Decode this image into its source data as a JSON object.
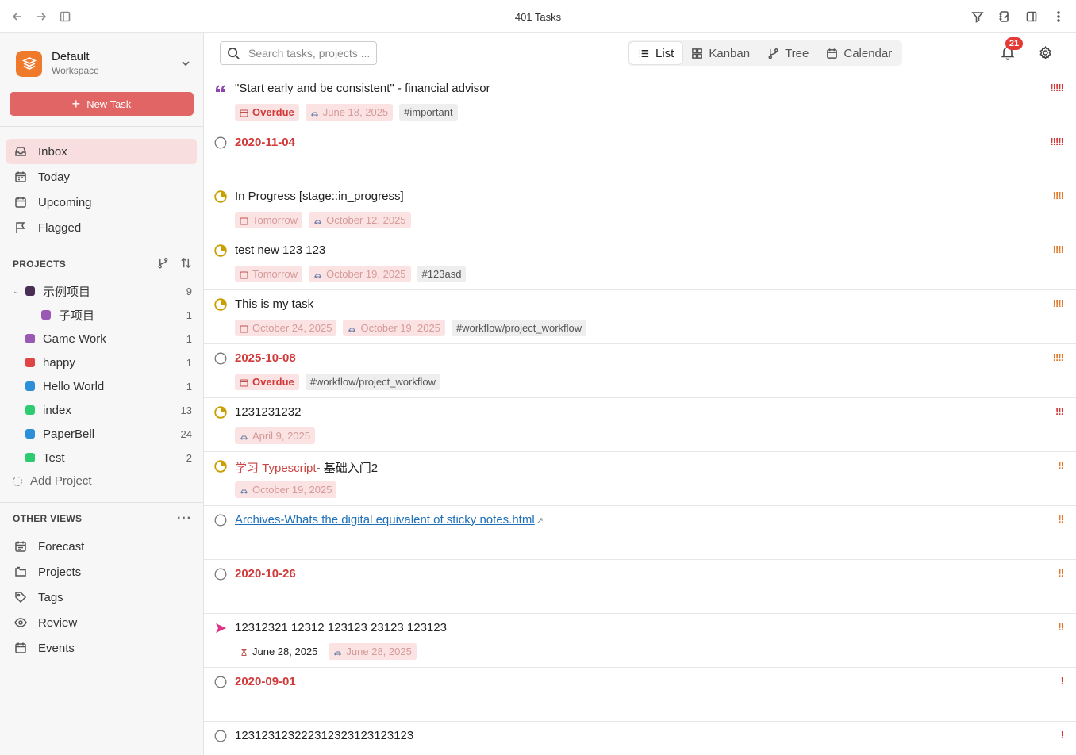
{
  "window": {
    "title": "401 Tasks"
  },
  "workspace": {
    "name": "Default",
    "subtitle": "Workspace"
  },
  "new_task_label": "New Task",
  "nav": [
    {
      "label": "Inbox",
      "icon": "inbox-icon",
      "active": true
    },
    {
      "label": "Today",
      "icon": "calendar-today-icon"
    },
    {
      "label": "Upcoming",
      "icon": "calendar-icon"
    },
    {
      "label": "Flagged",
      "icon": "flag-icon"
    }
  ],
  "projects_header": "PROJECTS",
  "projects": [
    {
      "name": "示例项目",
      "count": "9",
      "color": "#4a2f55",
      "expanded": true
    },
    {
      "name": "子项目",
      "count": "1",
      "color": "#9b59b6",
      "child": true
    },
    {
      "name": "Game Work",
      "count": "1",
      "color": "#9b59b6"
    },
    {
      "name": "happy",
      "count": "1",
      "color": "#e04545"
    },
    {
      "name": "Hello World",
      "count": "1",
      "color": "#2d8fd8"
    },
    {
      "name": "index",
      "count": "13",
      "color": "#2ecc71"
    },
    {
      "name": "PaperBell",
      "count": "24",
      "color": "#2d8fd8"
    },
    {
      "name": "Test",
      "count": "2",
      "color": "#2ecc71"
    }
  ],
  "add_project_label": "Add Project",
  "other_views_header": "OTHER VIEWS",
  "other_views": [
    {
      "label": "Forecast",
      "icon": "forecast-icon"
    },
    {
      "label": "Projects",
      "icon": "projects-icon"
    },
    {
      "label": "Tags",
      "icon": "tag-icon"
    },
    {
      "label": "Review",
      "icon": "eye-icon"
    },
    {
      "label": "Events",
      "icon": "events-icon"
    }
  ],
  "search": {
    "placeholder": "Search tasks, projects ..."
  },
  "view_tabs": [
    {
      "label": "List",
      "active": true
    },
    {
      "label": "Kanban"
    },
    {
      "label": "Tree"
    },
    {
      "label": "Calendar"
    }
  ],
  "notifications": {
    "count": "21"
  },
  "colors": {
    "accent": "#e26565",
    "overdue": "#d13a3a",
    "in_progress": "#c9a000",
    "quote": "#8e44ad",
    "prio_high": "#d13a3a",
    "prio_med": "#e07a2c"
  },
  "tasks": [
    {
      "status": "quote",
      "title": "\"Start early and be consistent\" - financial advisor",
      "priority": "!!!!!",
      "prio_color": "#d13a3a",
      "chips": [
        {
          "kind": "overdue",
          "text": "Overdue"
        },
        {
          "kind": "sched",
          "text": "June 18, 2025"
        },
        {
          "kind": "tag",
          "text": "#important"
        }
      ]
    },
    {
      "status": "empty",
      "title": "2020-11-04",
      "title_style": "date",
      "priority": "!!!!!",
      "prio_color": "#d13a3a",
      "chips": []
    },
    {
      "status": "progress",
      "title": "In Progress [stage::in_progress]",
      "priority": "!!!!",
      "prio_color": "#e07a2c",
      "chips": [
        {
          "kind": "due",
          "text": "Tomorrow"
        },
        {
          "kind": "sched",
          "text": "October 12, 2025"
        }
      ]
    },
    {
      "status": "progress",
      "title": "test new 123 123",
      "priority": "!!!!",
      "prio_color": "#e07a2c",
      "chips": [
        {
          "kind": "due",
          "text": "Tomorrow"
        },
        {
          "kind": "sched",
          "text": "October 19, 2025"
        },
        {
          "kind": "tag",
          "text": "#123asd"
        }
      ]
    },
    {
      "status": "progress",
      "title": "This is my task",
      "priority": "!!!!",
      "prio_color": "#e07a2c",
      "chips": [
        {
          "kind": "due",
          "text": "October 24, 2025"
        },
        {
          "kind": "sched",
          "text": "October 19, 2025"
        },
        {
          "kind": "tag",
          "text": "#workflow/project_workflow"
        }
      ]
    },
    {
      "status": "empty",
      "title": "2025-10-08",
      "title_style": "date",
      "priority": "!!!!",
      "prio_color": "#e07a2c",
      "chips": [
        {
          "kind": "overdue",
          "text": "Overdue"
        },
        {
          "kind": "tag",
          "text": "#workflow/project_workflow"
        }
      ]
    },
    {
      "status": "progress",
      "title": "1231231232",
      "priority": "!!!",
      "prio_color": "#d13a3a",
      "chips": [
        {
          "kind": "sched",
          "text": "April 9, 2025"
        }
      ]
    },
    {
      "status": "progress",
      "title_link": "学习 Typescript",
      "title_rest": "- 基础入门2",
      "link_style": "red",
      "priority": "!!",
      "prio_color": "#e07a2c",
      "chips": [
        {
          "kind": "sched",
          "text": "October 19, 2025"
        }
      ]
    },
    {
      "status": "empty",
      "title_link": "Archives-Whats the digital equivalent of sticky notes.html",
      "title_rest": "",
      "link_style": "blue",
      "external": true,
      "priority": "!!",
      "prio_color": "#e07a2c",
      "chips": []
    },
    {
      "status": "empty",
      "title": "2020-10-26",
      "title_style": "date",
      "priority": "!!",
      "prio_color": "#e07a2c",
      "chips": []
    },
    {
      "status": "forward",
      "title": "12312321 12312 123123 23123 123123",
      "priority": "!!",
      "prio_color": "#e07a2c",
      "chips": [
        {
          "kind": "start",
          "text": "June 28, 2025"
        },
        {
          "kind": "sched",
          "text": "June 28, 2025"
        }
      ]
    },
    {
      "status": "empty",
      "title": "2020-09-01",
      "title_style": "date",
      "priority": "!",
      "prio_color": "#d13a3a",
      "chips": []
    },
    {
      "status": "empty",
      "title": "12312312322231232312312312​3",
      "priority": "!",
      "prio_color": "#d13a3a",
      "chips": []
    }
  ]
}
